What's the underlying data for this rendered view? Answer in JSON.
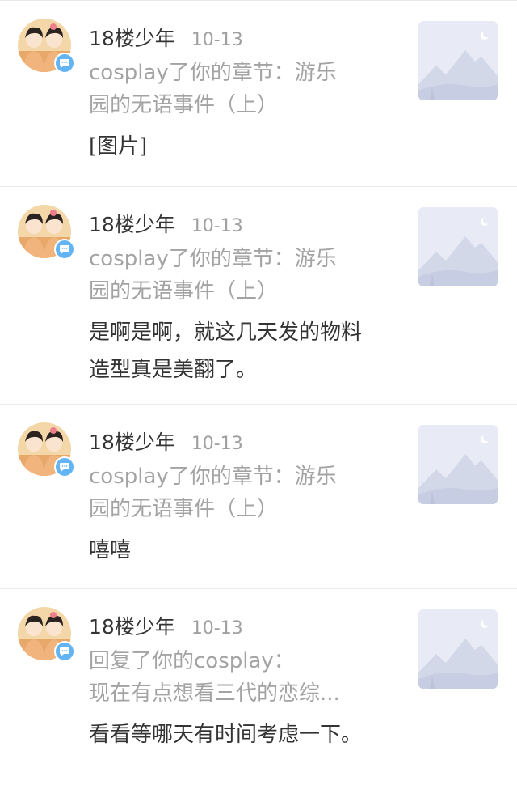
{
  "notifications": [
    {
      "user": "18楼少年",
      "time": "10-13",
      "ref_line1": "cosplay了你的章节：游乐",
      "ref_line2": "园的无语事件（上）",
      "message": "[图片]",
      "avatar_icon": "user-avatar",
      "badge_icon": "comment-bubble-icon",
      "thumb_icon": "image-placeholder-icon"
    },
    {
      "user": "18楼少年",
      "time": "10-13",
      "ref_line1": "cosplay了你的章节：游乐",
      "ref_line2": "园的无语事件（上）",
      "message": "是啊是啊，就这几天发的物料造型真是美翻了。",
      "avatar_icon": "user-avatar",
      "badge_icon": "comment-bubble-icon",
      "thumb_icon": "image-placeholder-icon"
    },
    {
      "user": "18楼少年",
      "time": "10-13",
      "ref_line1": "cosplay了你的章节：游乐",
      "ref_line2": "园的无语事件（上）",
      "message": "嘻嘻",
      "avatar_icon": "user-avatar",
      "badge_icon": "comment-bubble-icon",
      "thumb_icon": "image-placeholder-icon"
    },
    {
      "user": "18楼少年",
      "time": "10-13",
      "ref_line1": "回复了你的cosplay：",
      "ref_line2": "现在有点想看三代的恋综...",
      "message": "看看等哪天有时间考虑一下。",
      "avatar_icon": "user-avatar",
      "badge_icon": "comment-bubble-icon",
      "thumb_icon": "image-placeholder-icon"
    }
  ],
  "colors": {
    "name": "#333333",
    "time": "#a0a0a0",
    "ref": "#a3a3a3",
    "message": "#333333",
    "badge": "#62b4f4",
    "thumb_bg": "#e8ebf5",
    "divider": "#ebebeb"
  }
}
